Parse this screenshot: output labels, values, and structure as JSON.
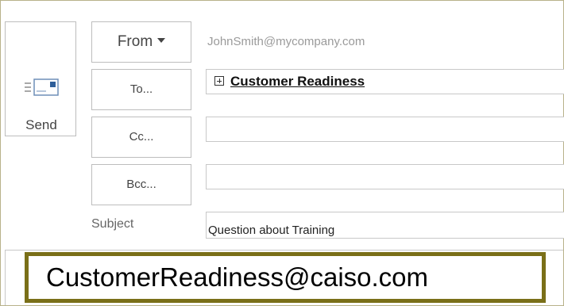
{
  "compose": {
    "send_label": "Send",
    "from_label": "From",
    "from_value": "JohnSmith@mycompany.com",
    "to_label": "To...",
    "cc_label": "Cc...",
    "bcc_label": "Bcc...",
    "subject_label": "Subject",
    "to_recipient": "Customer Readiness",
    "subject_value": "Question about Training",
    "cc_value": "",
    "bcc_value": ""
  },
  "callout": {
    "text": "CustomerReadiness@caiso.com"
  },
  "icons": {
    "send": "send-envelope-icon",
    "expand": "expand-plus-icon",
    "dropdown": "chevron-down-icon"
  },
  "colors": {
    "callout_border": "#7a6f18",
    "frame_border": "#b8b28a"
  }
}
